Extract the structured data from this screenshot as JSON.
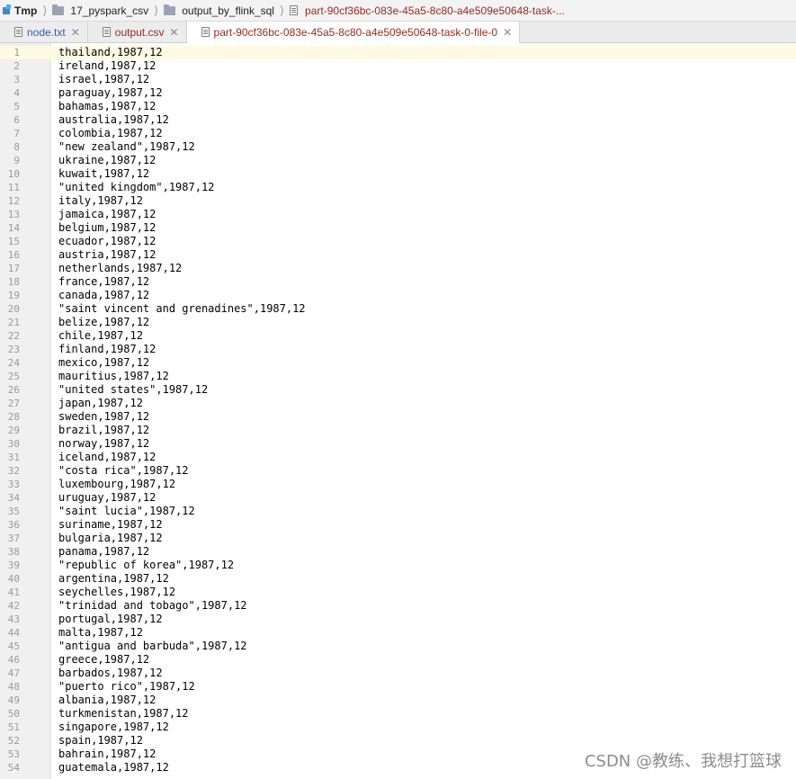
{
  "breadcrumb": {
    "items": [
      {
        "label": "Tmp",
        "icon": "module-icon"
      },
      {
        "label": "17_pyspark_csv",
        "icon": "folder-icon"
      },
      {
        "label": "output_by_flink_sql",
        "icon": "folder-icon"
      },
      {
        "label": "part-90cf36bc-083e-45a5-8c80-a4e509e50648-task-...",
        "icon": "text-file-icon"
      }
    ]
  },
  "tabs": [
    {
      "label": "node.txt",
      "icon": "text-file-icon",
      "color": "#2c5fb7",
      "active": false
    },
    {
      "label": "output.csv",
      "icon": "text-file-icon",
      "color": "#9b2a1e",
      "active": false
    },
    {
      "label": "part-90cf36bc-083e-45a5-8c80-a4e509e50648-task-0-file-0",
      "icon": "text-file-icon",
      "color": "#9b2a1e",
      "active": true
    }
  ],
  "editor": {
    "current_line": 1,
    "lines": [
      "thailand,1987,12",
      "ireland,1987,12",
      "israel,1987,12",
      "paraguay,1987,12",
      "bahamas,1987,12",
      "australia,1987,12",
      "colombia,1987,12",
      "\"new zealand\",1987,12",
      "ukraine,1987,12",
      "kuwait,1987,12",
      "\"united kingdom\",1987,12",
      "italy,1987,12",
      "jamaica,1987,12",
      "belgium,1987,12",
      "ecuador,1987,12",
      "austria,1987,12",
      "netherlands,1987,12",
      "france,1987,12",
      "canada,1987,12",
      "\"saint vincent and grenadines\",1987,12",
      "belize,1987,12",
      "chile,1987,12",
      "finland,1987,12",
      "mexico,1987,12",
      "mauritius,1987,12",
      "\"united states\",1987,12",
      "japan,1987,12",
      "sweden,1987,12",
      "brazil,1987,12",
      "norway,1987,12",
      "iceland,1987,12",
      "\"costa rica\",1987,12",
      "luxembourg,1987,12",
      "uruguay,1987,12",
      "\"saint lucia\",1987,12",
      "suriname,1987,12",
      "bulgaria,1987,12",
      "panama,1987,12",
      "\"republic of korea\",1987,12",
      "argentina,1987,12",
      "seychelles,1987,12",
      "\"trinidad and tobago\",1987,12",
      "portugal,1987,12",
      "malta,1987,12",
      "\"antigua and barbuda\",1987,12",
      "greece,1987,12",
      "barbados,1987,12",
      "\"puerto rico\",1987,12",
      "albania,1987,12",
      "turkmenistan,1987,12",
      "singapore,1987,12",
      "spain,1987,12",
      "bahrain,1987,12",
      "guatemala,1987,12"
    ]
  },
  "watermark": "CSDN @教练、我想打篮球"
}
